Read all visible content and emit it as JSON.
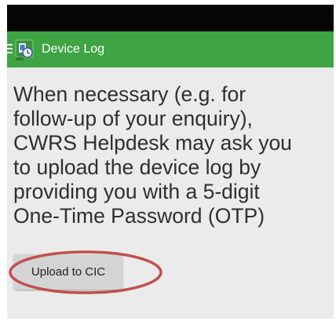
{
  "status_bar": {},
  "app_bar": {
    "title": "Device Log",
    "background_color": "#3fa444",
    "menu_icon": "menu-icon",
    "app_icon": "device-log-app-icon"
  },
  "content": {
    "message": "When necessary (e.g. for\nfollow-up of your enquiry),\nCWRS Helpdesk may ask you\nto upload the device log by\nproviding you with a 5-digit\nOne-Time Password (OTP)",
    "upload_button_label": "Upload to CIC"
  },
  "annotation": {
    "ellipse_color": "#c0504d"
  }
}
